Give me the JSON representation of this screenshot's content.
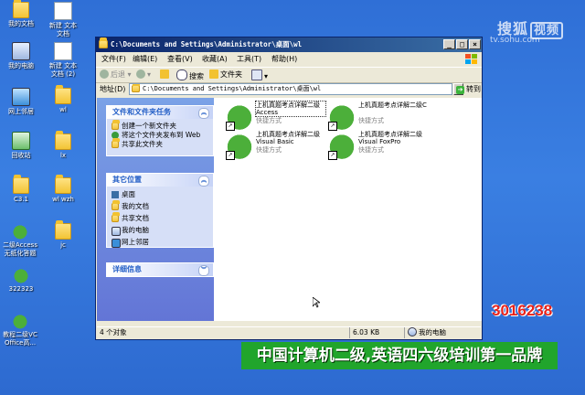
{
  "desktop": {
    "icons": [
      {
        "label": "我的文档",
        "icon": "my-documents-icon"
      },
      {
        "label": "新建 文本文档",
        "icon": "text-doc-icon"
      },
      {
        "label": "我的电脑",
        "icon": "my-computer-icon"
      },
      {
        "label": "新建 文本文档 (2)",
        "icon": "text-doc-icon"
      },
      {
        "label": "网上邻居",
        "icon": "network-icon"
      },
      {
        "label": "wl",
        "icon": "folder-icon"
      },
      {
        "label": "回收站",
        "icon": "recycle-bin-icon"
      },
      {
        "label": "lx",
        "icon": "folder-icon"
      },
      {
        "label": "C3.1",
        "icon": "folder-icon"
      },
      {
        "label": "wl wzh",
        "icon": "folder-icon"
      },
      {
        "label": "二级Access无纸化答题",
        "icon": "frog-shortcut-icon"
      },
      {
        "label": "jc",
        "icon": "folder-icon"
      },
      {
        "label": "322323",
        "icon": "frog-icon"
      },
      {
        "label": "教程二级VC Office高...",
        "icon": "frog-shortcut-icon"
      }
    ]
  },
  "watermark": {
    "brand": "搜狐",
    "brand_box": "视频",
    "url": "tv.sohu.com"
  },
  "window": {
    "title": "C:\\Documents and Settings\\Administrator\\桌面\\wl",
    "menu": [
      "文件(F)",
      "编辑(E)",
      "查看(V)",
      "收藏(A)",
      "工具(T)",
      "帮助(H)"
    ],
    "toolbar": {
      "back": "后退",
      "search": "搜索",
      "folders": "文件夹"
    },
    "address": {
      "label": "地址(D)",
      "value": "C:\\Documents and Settings\\Administrator\\桌面\\wl",
      "go": "转到"
    },
    "tasks": {
      "title": "文件和文件夹任务",
      "items": [
        "创建一个新文件夹",
        "将这个文件夹发布到 Web",
        "共享此文件夹"
      ]
    },
    "places": {
      "title": "其它位置",
      "items": [
        "桌面",
        "我的文档",
        "共享文档",
        "我的电脑",
        "网上邻居"
      ]
    },
    "details": {
      "title": "详细信息"
    },
    "files": [
      {
        "name": "上机真题考点详解二级Access",
        "type": "快捷方式"
      },
      {
        "name": "上机真题考点详解二级C",
        "type": "快捷方式"
      },
      {
        "name": "上机真题考点详解二级Visual Basic",
        "type": "快捷方式"
      },
      {
        "name": "上机真题考点详解二级Visual FoxPro",
        "type": "快捷方式"
      }
    ],
    "status": {
      "count": "4 个对象",
      "size": "6.03 KB",
      "location": "我的电脑"
    }
  },
  "overlay": {
    "phone": "3016238",
    "banner": "中国计算机二级,英语四六级培训第一品牌"
  }
}
